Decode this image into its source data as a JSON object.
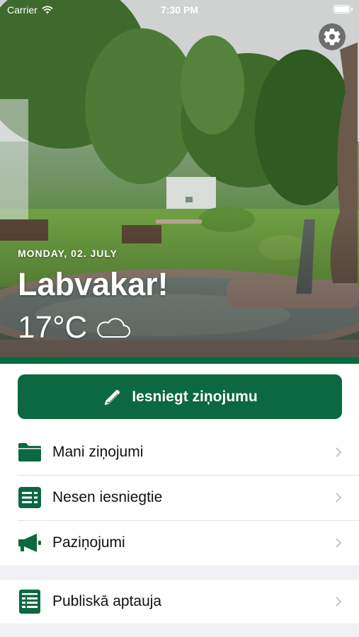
{
  "status_bar": {
    "carrier": "Carrier",
    "time": "7:30 PM"
  },
  "hero": {
    "date": "MONDAY, 02. JULY",
    "greeting": "Labvakar!",
    "temperature": "17°C",
    "weather_icon": "cloud-icon",
    "settings_icon": "gear-icon"
  },
  "submit_button": {
    "label": "Iesniegt ziņojumu",
    "icon": "pencil-icon"
  },
  "menu": [
    {
      "label": "Mani ziņojumi",
      "icon": "folder-icon"
    },
    {
      "label": "Nesen iesniegtie",
      "icon": "list-icon"
    },
    {
      "label": "Paziņojumi",
      "icon": "megaphone-icon"
    }
  ],
  "menu_secondary": [
    {
      "label": "Publiskā aptauja",
      "icon": "survey-icon"
    }
  ],
  "colors": {
    "accent": "#0b6840",
    "background": "#efeff4",
    "separator": "#e3e3e6"
  }
}
